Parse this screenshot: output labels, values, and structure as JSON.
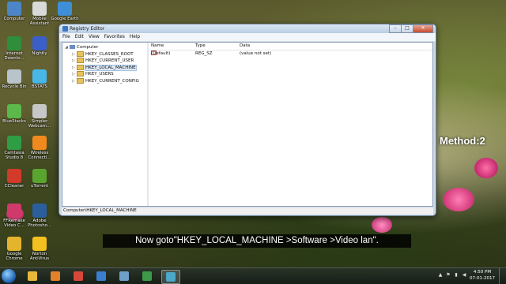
{
  "desktop": {
    "icons": [
      {
        "label": "Computer",
        "color": "#4d86c8"
      },
      {
        "label": "Mobile Assistant",
        "color": "#d9d9d9"
      },
      {
        "label": "Google Earth",
        "color": "#3f8fd8"
      },
      {
        "label": "Internet Downlo...",
        "color": "#2f8e3c"
      },
      {
        "label": "Nightly",
        "color": "#3a5fc9"
      },
      {
        "label": "Recycle Bin",
        "color": "#b8c3cc"
      },
      {
        "label": "BSTATS",
        "color": "#48b7e8"
      },
      {
        "label": "BlueStacks",
        "color": "#5cb84a"
      },
      {
        "label": "Simpler Webcam...",
        "color": "#c7c7c7"
      },
      {
        "label": "Camtasia Studio 8",
        "color": "#2f9d44"
      },
      {
        "label": "Wireless Connecti...",
        "color": "#f08a1e"
      },
      {
        "label": "CCleaner",
        "color": "#d23a2a"
      },
      {
        "label": "uTorrent",
        "color": "#5aa52f"
      },
      {
        "label": "FFRemake Video C...",
        "color": "#cf3a6b"
      },
      {
        "label": "Adobe Photosho...",
        "color": "#2b5e9d"
      },
      {
        "label": "Google Chrome",
        "color": "#e4b52c"
      },
      {
        "label": "Norton AntiVirus",
        "color": "#f2c11f"
      }
    ]
  },
  "window": {
    "title": "Registry Editor",
    "controls": {
      "minimize": "–",
      "maximize": "□",
      "close": "✕"
    },
    "menu": [
      "File",
      "Edit",
      "View",
      "Favorites",
      "Help"
    ],
    "tree": {
      "root": "Computer",
      "keys": [
        "HKEY_CLASSES_ROOT",
        "HKEY_CURRENT_USER",
        "HKEY_LOCAL_MACHINE",
        "HKEY_USERS",
        "HKEY_CURRENT_CONFIG"
      ],
      "selected": "HKEY_LOCAL_MACHINE"
    },
    "list": {
      "columns": [
        "Name",
        "Type",
        "Data"
      ],
      "rows": [
        {
          "name": "(Default)",
          "type": "REG_SZ",
          "data": "(value not set)"
        }
      ]
    },
    "status": "Computer\\HKEY_LOCAL_MACHINE"
  },
  "overlay": {
    "method": "Method:2",
    "caption": "Now goto\"HKEY_LOCAL_MACHINE >Software >Video lan\"."
  },
  "taskbar": {
    "time": "4:50 PM",
    "date": "07-01-2017",
    "apps": [
      {
        "name": "explorer",
        "color": "#e8b83a"
      },
      {
        "name": "media-player",
        "color": "#e3822a"
      },
      {
        "name": "chrome",
        "color": "#d8483a"
      },
      {
        "name": "ie",
        "color": "#3b7fd0"
      },
      {
        "name": "screen-capture",
        "color": "#6fa0c8"
      },
      {
        "name": "camtasia",
        "color": "#3c9a48"
      },
      {
        "name": "registry",
        "color": "#4aa8c8"
      }
    ]
  }
}
